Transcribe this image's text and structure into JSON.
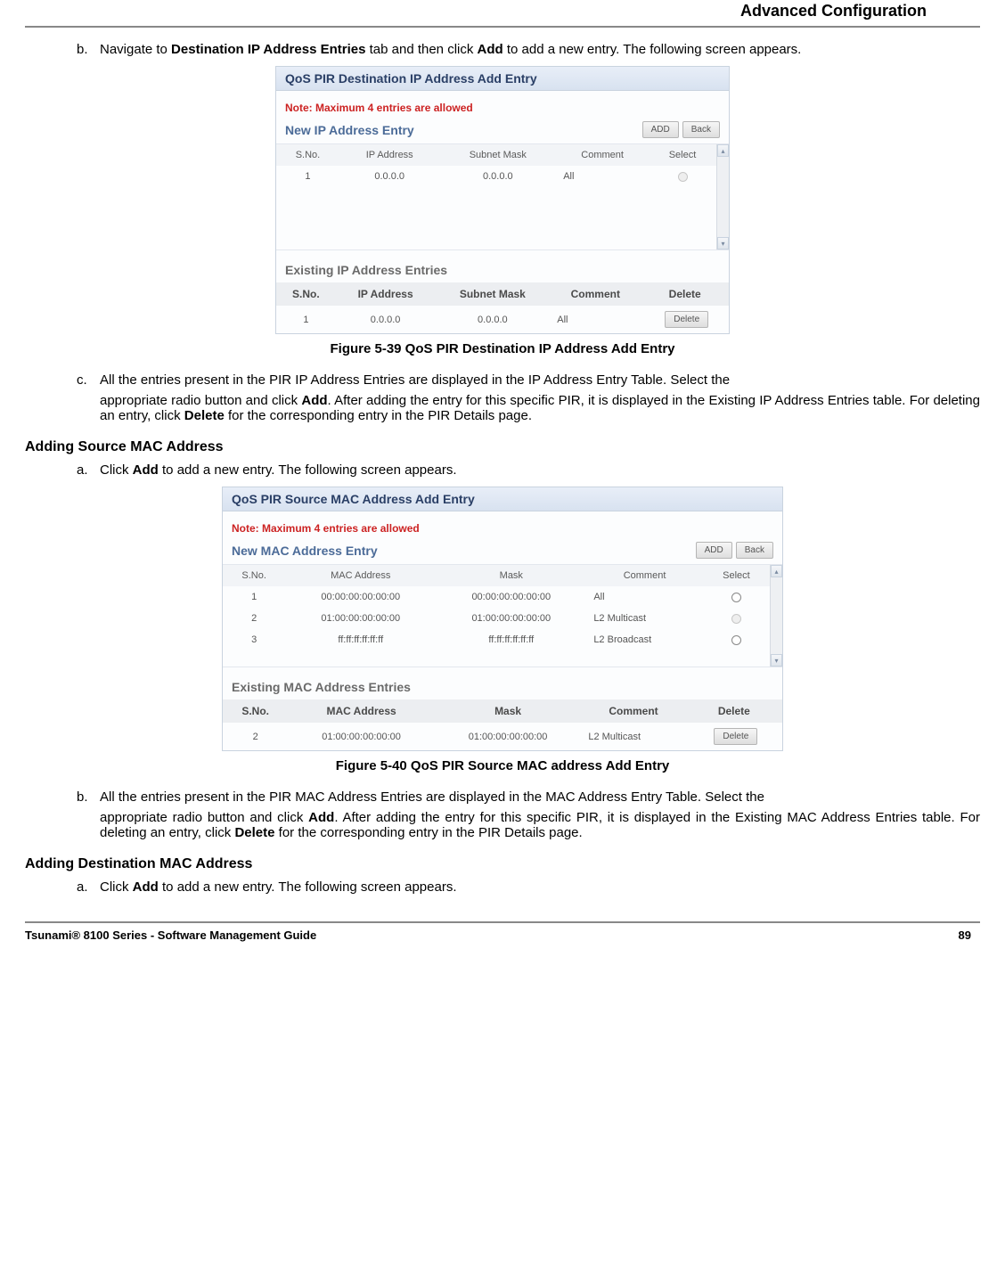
{
  "header": {
    "title": "Advanced Configuration"
  },
  "body": {
    "step_b": {
      "letter": "b.",
      "text_pre": "Navigate to ",
      "bold1": "Destination IP Address Entries",
      "text_mid": " tab and then click ",
      "bold2": "Add",
      "text_post": " to add a new entry. The following screen appears."
    },
    "panel_ip": {
      "title": "QoS PIR Destination IP Address Add Entry",
      "note": "Note: Maximum 4 entries are allowed",
      "new_title": "New IP Address Entry",
      "btn_add": "ADD",
      "btn_back": "Back",
      "new_headers": [
        "S.No.",
        "IP Address",
        "Subnet Mask",
        "Comment",
        "Select"
      ],
      "new_rows": [
        {
          "sno": "1",
          "ip": "0.0.0.0",
          "mask": "0.0.0.0",
          "comment": "All",
          "selectable": false
        }
      ],
      "exist_title": "Existing IP Address Entries",
      "exist_headers": [
        "S.No.",
        "IP Address",
        "Subnet Mask",
        "Comment",
        "Delete"
      ],
      "exist_rows": [
        {
          "sno": "1",
          "ip": "0.0.0.0",
          "mask": "0.0.0.0",
          "comment": "All",
          "del": "Delete"
        }
      ]
    },
    "fig39": "Figure 5-39 QoS PIR Destination IP Address Add Entry",
    "step_c": {
      "letter": "c.",
      "line1": "All the entries present in the PIR IP Address Entries are displayed in the IP Address Entry Table. Select the",
      "line2_pre": "appropriate radio button and click ",
      "bold_add": "Add",
      "line2_mid": ". After adding the entry for this specific PIR, it is displayed in the Existing IP Address Entries table. For deleting an entry, click ",
      "bold_del": "Delete",
      "line2_post": " for the corresponding entry in the PIR Details page."
    },
    "heading_src_mac": "Adding Source MAC Address",
    "step_a1": {
      "letter": "a.",
      "pre": "Click ",
      "bold": "Add",
      "post": " to add a new entry. The following screen appears."
    },
    "panel_mac": {
      "title": "QoS PIR Source MAC Address Add Entry",
      "note": "Note: Maximum 4 entries are allowed",
      "new_title": "New MAC Address Entry",
      "btn_add": "ADD",
      "btn_back": "Back",
      "new_headers": [
        "S.No.",
        "MAC Address",
        "Mask",
        "Comment",
        "Select"
      ],
      "new_rows": [
        {
          "sno": "1",
          "mac": "00:00:00:00:00:00",
          "mask": "00:00:00:00:00:00",
          "comment": "All",
          "selectable": true
        },
        {
          "sno": "2",
          "mac": "01:00:00:00:00:00",
          "mask": "01:00:00:00:00:00",
          "comment": "L2 Multicast",
          "selectable": false
        },
        {
          "sno": "3",
          "mac": "ff:ff:ff:ff:ff:ff",
          "mask": "ff:ff:ff:ff:ff:ff",
          "comment": "L2 Broadcast",
          "selectable": true
        }
      ],
      "exist_title": "Existing MAC Address Entries",
      "exist_headers": [
        "S.No.",
        "MAC Address",
        "Mask",
        "Comment",
        "Delete"
      ],
      "exist_rows": [
        {
          "sno": "2",
          "mac": "01:00:00:00:00:00",
          "mask": "01:00:00:00:00:00",
          "comment": "L2 Multicast",
          "del": "Delete"
        }
      ]
    },
    "fig40": "Figure 5-40 QoS PIR Source MAC address Add Entry",
    "step_b2": {
      "letter": "b.",
      "line1": "All the entries present in the PIR MAC Address Entries are displayed in the MAC Address Entry Table. Select the",
      "line2_pre": "appropriate radio button and click ",
      "bold_add": "Add",
      "line2_mid": ". After adding the entry for this specific PIR, it is displayed in the Existing MAC Address Entries table. For deleting an entry, click ",
      "bold_del": "Delete",
      "line2_post": " for the corresponding entry in the PIR Details page."
    },
    "heading_dst_mac": "Adding Destination MAC Address",
    "step_a2": {
      "letter": "a.",
      "pre": "Click ",
      "bold": "Add",
      "post": " to add a new entry. The following screen appears."
    }
  },
  "footer": {
    "left": "Tsunami® 8100 Series - Software Management Guide",
    "right": "89"
  }
}
